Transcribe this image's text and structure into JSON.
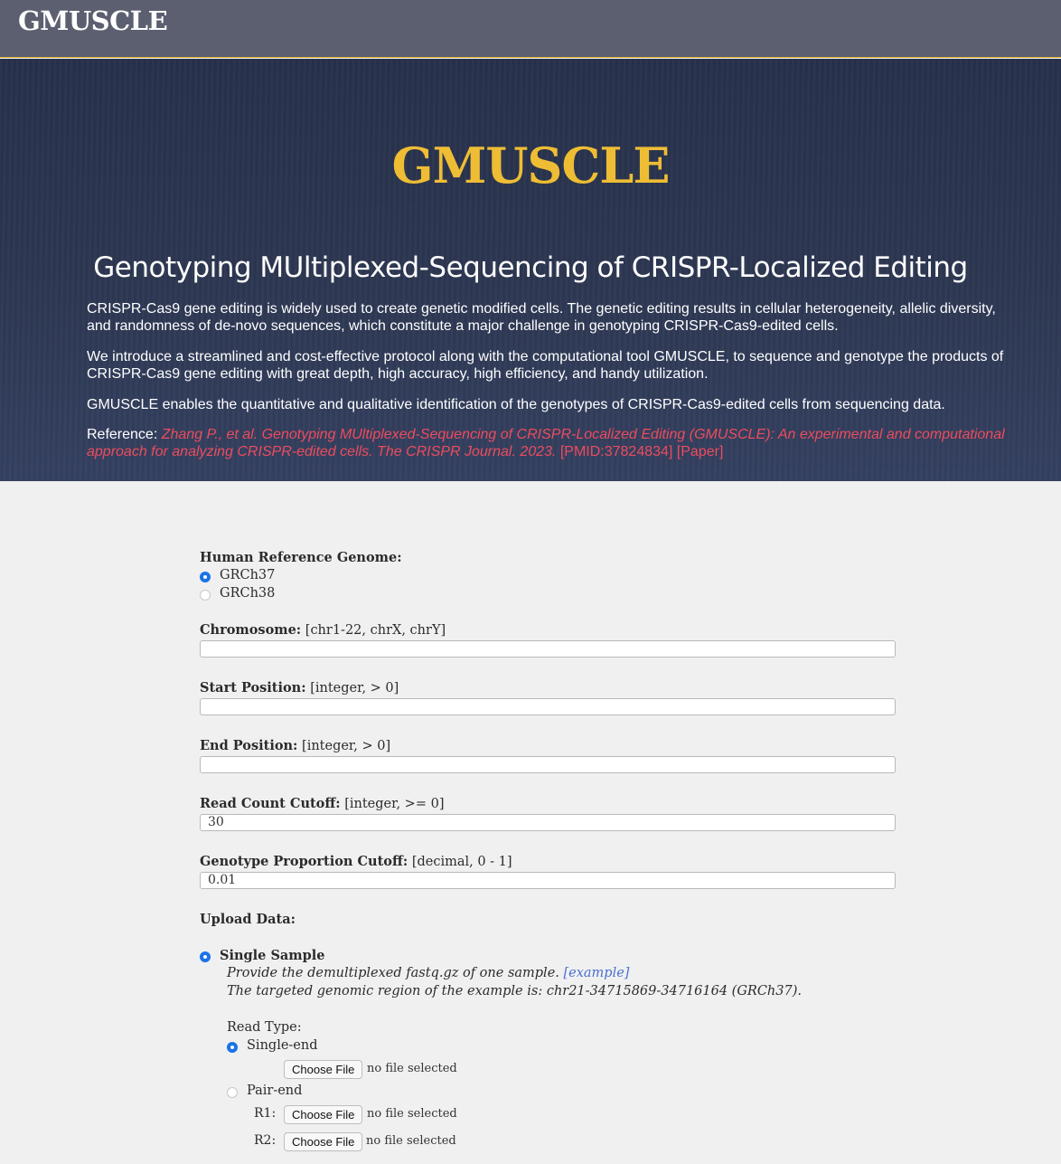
{
  "navbar": {
    "brand": "GMUSCLE"
  },
  "hero": {
    "title": "GMUSCLE",
    "subtitle": "Genotyping MUltiplexed-Sequencing of CRISPR-Localized Editing",
    "paragraphs": [
      "CRISPR-Cas9 gene editing is widely used to create genetic modified cells. The genetic editing results in cellular heterogeneity, allelic diversity, and randomness of de-novo sequences, which constitute a major challenge in genotyping CRISPR-Cas9-edited cells.",
      "We introduce a streamlined and cost-effective protocol along with the computational tool GMUSCLE, to sequence and genotype the products of CRISPR-Cas9 gene editing with great depth, high accuracy, high efficiency, and handy utilization.",
      "GMUSCLE enables the quantitative and qualitative identification of the genotypes of CRISPR-Cas9-edited cells from sequencing data."
    ],
    "reference": {
      "label": "Reference: ",
      "citation": "Zhang P., et al. Genotyping MUltiplexed-Sequencing of CRISPR-Localized Editing (GMUSCLE): An experimental and computational approach for analyzing CRISPR-edited cells. The CRISPR Journal. 2023.",
      "pmid": "[PMID:37824834]",
      "paper": "[Paper]"
    }
  },
  "form": {
    "genome": {
      "label": "Human Reference Genome:",
      "options": [
        "GRCh37",
        "GRCh38"
      ],
      "selected": "GRCh37"
    },
    "chromosome": {
      "label": "Chromosome:",
      "hint": "[chr1-22, chrX, chrY]",
      "value": ""
    },
    "start": {
      "label": "Start Position:",
      "hint": "[integer, > 0]",
      "value": ""
    },
    "end": {
      "label": "End Position:",
      "hint": "[integer, > 0]",
      "value": ""
    },
    "read_count": {
      "label": "Read Count Cutoff:",
      "hint": "[integer, >= 0]",
      "value": "30"
    },
    "genotype_prop": {
      "label": "Genotype Proportion Cutoff:",
      "hint": "[decimal, 0 - 1]",
      "value": "0.01"
    },
    "upload": {
      "label": "Upload Data:",
      "single_sample": {
        "label": "Single Sample",
        "desc": "Provide the demultiplexed fastq.gz of one sample. ",
        "example_link": "[example]",
        "region_note": "The targeted genomic region of the example is: chr21-34715869-34716164 (GRCh37).",
        "read_type_label": "Read Type:",
        "single_end": "Single-end",
        "pair_end": "Pair-end",
        "r1": "R1:",
        "r2": "R2:",
        "choose_file": "Choose File",
        "no_file": "no file selected"
      }
    }
  },
  "colors": {
    "accent": "#eebd34",
    "reference": "#ec4c5e",
    "radio": "#1a73e8",
    "navbar": "#5c5f70"
  }
}
